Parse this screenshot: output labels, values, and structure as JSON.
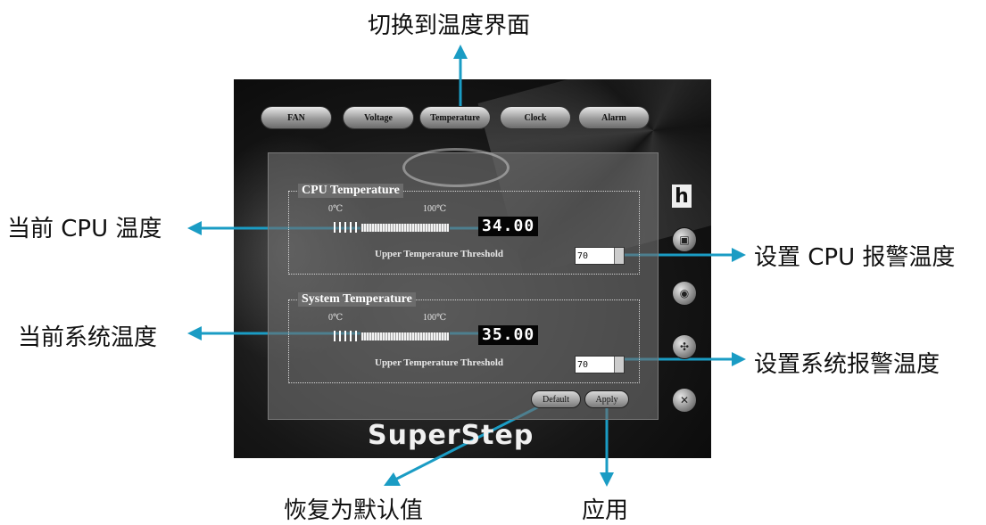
{
  "tabs": [
    {
      "label": "FAN"
    },
    {
      "label": "Voltage"
    },
    {
      "label": "Temperature"
    },
    {
      "label": "Clock"
    },
    {
      "label": "Alarm"
    }
  ],
  "cpu": {
    "title": "CPU Temperature",
    "scale_min": "0℃",
    "scale_max": "100℃",
    "reading": "34.00",
    "threshold_label": "Upper Temperature Threshold",
    "threshold_value": "70"
  },
  "system": {
    "title": "System Temperature",
    "scale_min": "0℃",
    "scale_max": "100℃",
    "reading": "35.00",
    "threshold_label": "Upper Temperature Threshold",
    "threshold_value": "70"
  },
  "buttons": {
    "default": "Default",
    "apply": "Apply"
  },
  "brand": "SuperStep",
  "side_icons": [
    "h-logo-icon",
    "monitor-icon",
    "disk-icon",
    "fan-icon",
    "tools-icon"
  ],
  "annotations": {
    "top": "切换到温度界面",
    "cpu_temp": "当前 CPU 温度",
    "sys_temp": "当前系统温度",
    "cpu_alarm": "设置 CPU 报警温度",
    "sys_alarm": "设置系统报警温度",
    "default": "恢复为默认值",
    "apply": "应用"
  },
  "colors": {
    "arrow": "#1a9cc4",
    "panel": "#6e6e6e"
  }
}
